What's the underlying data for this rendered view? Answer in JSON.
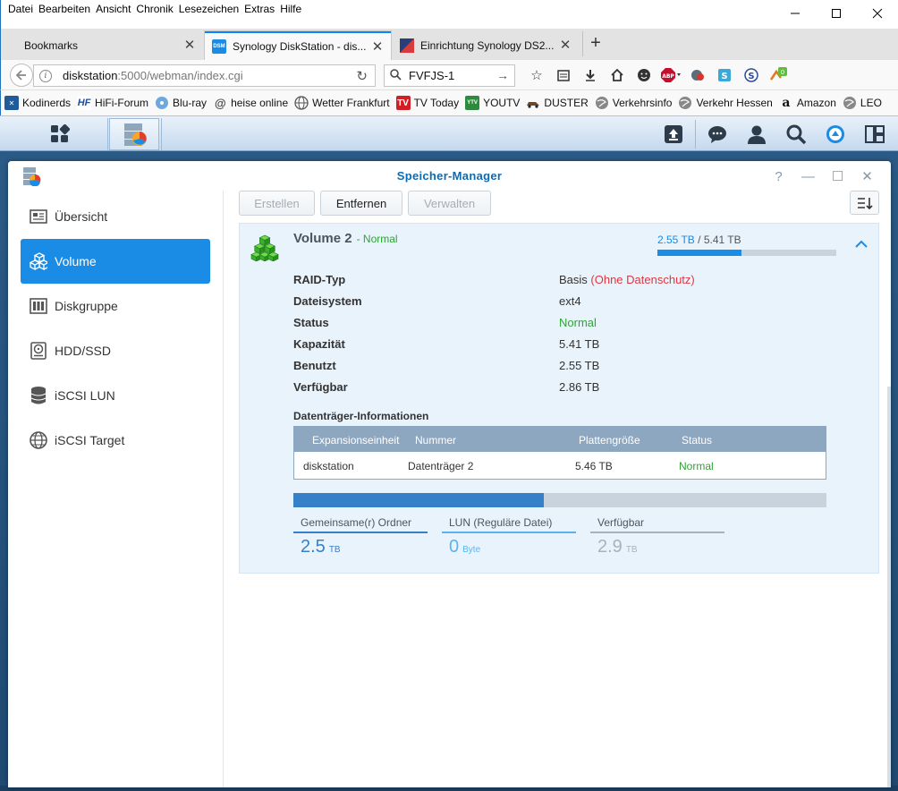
{
  "browser": {
    "menu": [
      "Datei",
      "Bearbeiten",
      "Ansicht",
      "Chronik",
      "Lesezeichen",
      "Extras",
      "Hilfe"
    ],
    "tabs": [
      {
        "label": "Bookmarks"
      },
      {
        "label": "Synology DiskStation - dis..."
      },
      {
        "label": "Einrichtung Synology DS2..."
      }
    ],
    "url_host": "diskstation",
    "url_rest": ":5000/webman/index.cgi",
    "search_value": "FVFJS-1",
    "bookmarks": [
      "Kodinerds",
      "HiFi-Forum",
      "Blu-ray",
      "heise online",
      "Wetter Frankfurt",
      "TV Today",
      "YOUTV",
      "DUSTER",
      "Verkehrsinfo",
      "Verkehr Hessen",
      "Amazon",
      "LEO"
    ],
    "bookmark_badges": {
      "hifi": "HF",
      "yotv": "YTV",
      "abp": "ABP",
      "addon": "0"
    }
  },
  "window": {
    "title": "Speicher-Manager",
    "controls": {
      "help": "?",
      "minimize": "—",
      "maximize": "☐",
      "close": "✕"
    }
  },
  "sidebar": {
    "items": [
      {
        "label": "Übersicht",
        "icon": "overview-icon"
      },
      {
        "label": "Volume",
        "icon": "volume-icon"
      },
      {
        "label": "Diskgruppe",
        "icon": "diskgroup-icon"
      },
      {
        "label": "HDD/SSD",
        "icon": "hdd-icon"
      },
      {
        "label": "iSCSI LUN",
        "icon": "lun-icon"
      },
      {
        "label": "iSCSI Target",
        "icon": "target-icon"
      }
    ],
    "active_index": 1
  },
  "toolbar": {
    "create": "Erstellen",
    "remove": "Entfernen",
    "manage": "Verwalten"
  },
  "volume": {
    "name": "Volume 2",
    "status": "- Normal",
    "used": "2.55 TB",
    "total": " / 5.41 TB",
    "usage_fraction": 0.47,
    "properties": [
      {
        "label": "RAID-Typ",
        "value": "Basis ",
        "extra": "(Ohne Datenschutz)"
      },
      {
        "label": "Dateisystem",
        "value": "ext4"
      },
      {
        "label": "Status",
        "value": "Normal"
      },
      {
        "label": "Kapazität",
        "value": "5.41 TB"
      },
      {
        "label": "Benutzt",
        "value": "2.55 TB"
      },
      {
        "label": "Verfügbar",
        "value": "2.86 TB"
      }
    ]
  },
  "disks": {
    "title": "Datenträger-Informationen",
    "columns": [
      "Expansionseinheit",
      "Nummer",
      "Plattengröße",
      "Status"
    ],
    "rows": [
      {
        "unit": "diskstation",
        "number": "Datenträger 2",
        "size": "5.46 TB",
        "status": "Normal"
      }
    ]
  },
  "breakdown": {
    "fill_fraction": 0.47,
    "items": [
      {
        "label": "Gemeinsame(r) Ordner",
        "value": "2.5",
        "unit": "TB",
        "color": "#3580c8"
      },
      {
        "label": "LUN (Reguläre Datei)",
        "value": "0",
        "unit": "Byte",
        "color": "#59b3f0"
      },
      {
        "label": "Verfügbar",
        "value": "2.9",
        "unit": "TB",
        "color": "#a8b2bc"
      }
    ]
  },
  "colors": {
    "accent": "#1a8ce5",
    "normal_green": "#2ea334",
    "warning_red": "#e2363e"
  }
}
